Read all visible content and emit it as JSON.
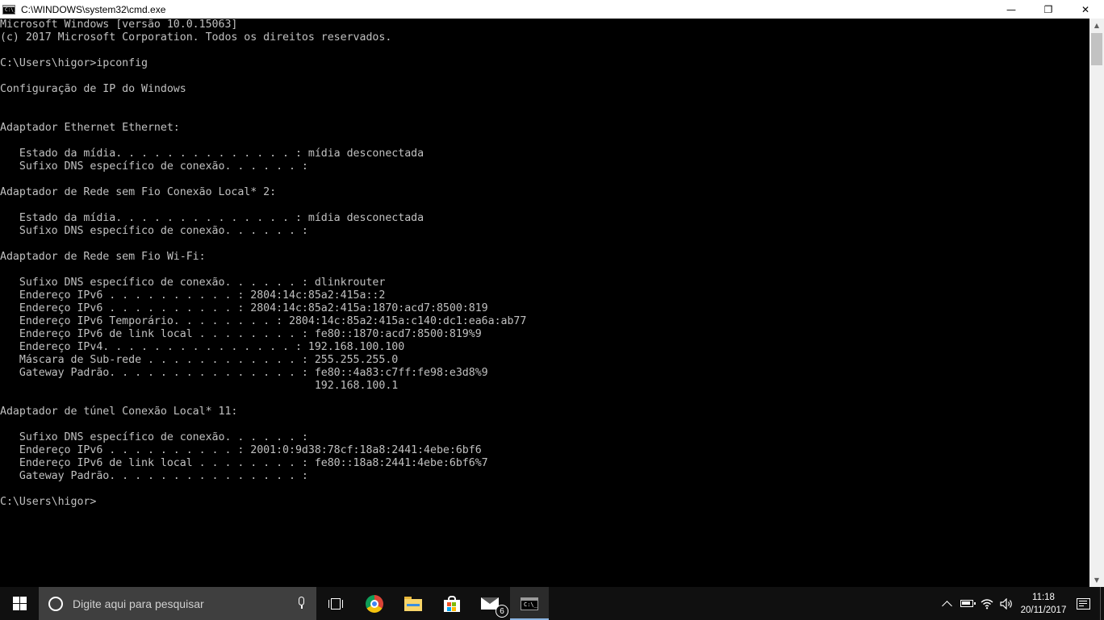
{
  "window": {
    "title": "C:\\WINDOWS\\system32\\cmd.exe",
    "icon": "cmd-icon",
    "controls": {
      "minimize": "—",
      "maximize": "❐",
      "close": "✕"
    }
  },
  "console": {
    "lines": [
      "Microsoft Windows [versão 10.0.15063]",
      "(c) 2017 Microsoft Corporation. Todos os direitos reservados.",
      "",
      "C:\\Users\\higor>ipconfig",
      "",
      "Configuração de IP do Windows",
      "",
      "",
      "Adaptador Ethernet Ethernet:",
      "",
      "   Estado da mídia. . . . . . . . . . . . . . : mídia desconectada",
      "   Sufixo DNS específico de conexão. . . . . . :",
      "",
      "Adaptador de Rede sem Fio Conexão Local* 2:",
      "",
      "   Estado da mídia. . . . . . . . . . . . . . : mídia desconectada",
      "   Sufixo DNS específico de conexão. . . . . . :",
      "",
      "Adaptador de Rede sem Fio Wi-Fi:",
      "",
      "   Sufixo DNS específico de conexão. . . . . . : dlinkrouter",
      "   Endereço IPv6 . . . . . . . . . . : 2804:14c:85a2:415a::2",
      "   Endereço IPv6 . . . . . . . . . . : 2804:14c:85a2:415a:1870:acd7:8500:819",
      "   Endereço IPv6 Temporário. . . . . . . . : 2804:14c:85a2:415a:c140:dc1:ea6a:ab77",
      "   Endereço IPv6 de link local . . . . . . . . : fe80::1870:acd7:8500:819%9",
      "   Endereço IPv4. . . . . . . . . . . . . . . : 192.168.100.100",
      "   Máscara de Sub-rede . . . . . . . . . . . . : 255.255.255.0",
      "   Gateway Padrão. . . . . . . . . . . . . . . : fe80::4a83:c7ff:fe98:e3d8%9",
      "                                                 192.168.100.1",
      "",
      "Adaptador de túnel Conexão Local* 11:",
      "",
      "   Sufixo DNS específico de conexão. . . . . . :",
      "   Endereço IPv6 . . . . . . . . . . : 2001:0:9d38:78cf:18a8:2441:4ebe:6bf6",
      "   Endereço IPv6 de link local . . . . . . . . : fe80::18a8:2441:4ebe:6bf6%7",
      "   Gateway Padrão. . . . . . . . . . . . . . . :",
      "",
      "C:\\Users\\higor>"
    ]
  },
  "taskbar": {
    "search_placeholder": "Digite aqui para pesquisar",
    "mail_badge": "6",
    "cmd_glyph": "C:\\_",
    "clock_time": "11:18",
    "clock_date": "20/11/2017"
  }
}
